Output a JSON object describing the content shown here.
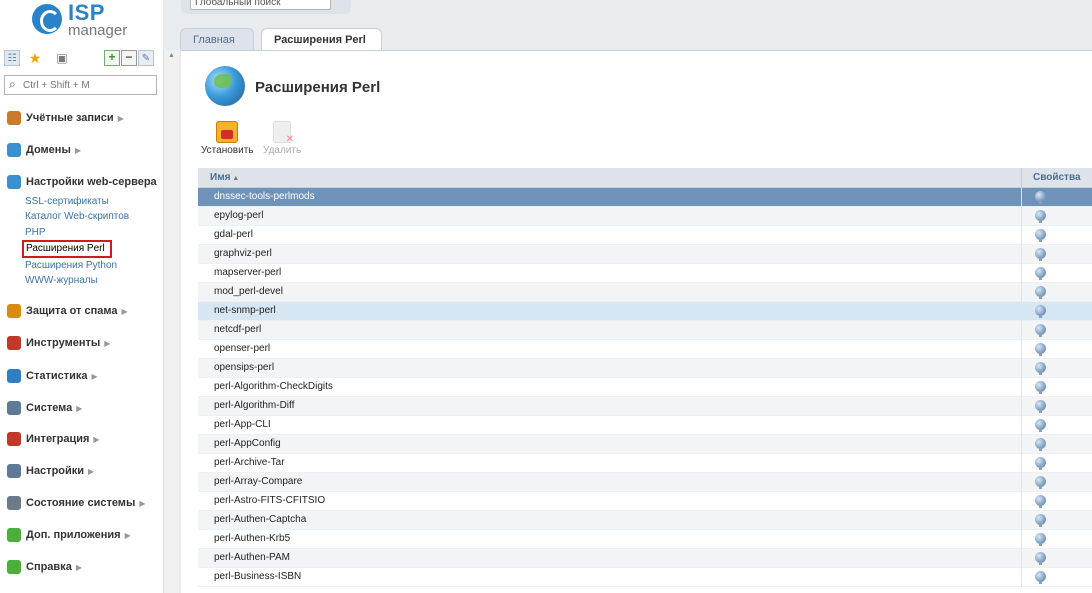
{
  "app": {
    "logo_main": "ISP",
    "logo_sub": "manager"
  },
  "global_search": {
    "placeholder": "Глобальный поиск"
  },
  "sidebar": {
    "search_placeholder": "Ctrl + Shift + M",
    "groups": [
      {
        "label": "Учётные записи",
        "icon": "users-icon",
        "color": "#c97a2b"
      },
      {
        "label": "Домены",
        "icon": "globe-icon",
        "color": "#3a8fcf"
      },
      {
        "label": "Настройки web-сервера",
        "icon": "web-globe-icon",
        "color": "#3a8fcf",
        "items": [
          "SSL-сертификаты",
          "Каталог Web-скриптов",
          "PHP",
          "Расширения Perl",
          "Расширения Python",
          "WWW-журналы"
        ]
      },
      {
        "label": "Защита от спама",
        "icon": "shield-icon",
        "color": "#d98a12"
      },
      {
        "label": "Инструменты",
        "icon": "tools-icon",
        "color": "#c0392b"
      },
      {
        "label": "Статистика",
        "icon": "pie-chart-icon",
        "color": "#2f7ec4"
      },
      {
        "label": "Система",
        "icon": "system-icon",
        "color": "#5f7a96"
      },
      {
        "label": "Интеграция",
        "icon": "puzzle-icon",
        "color": "#c0392b"
      },
      {
        "label": "Настройки",
        "icon": "settings-icon",
        "color": "#5f7a96"
      },
      {
        "label": "Состояние системы",
        "icon": "monitor-icon",
        "color": "#6b7b8a"
      },
      {
        "label": "Доп. приложения",
        "icon": "plus-icon",
        "color": "#4caf3c"
      },
      {
        "label": "Справка",
        "icon": "help-icon",
        "color": "#4caf3c"
      }
    ]
  },
  "tabs": [
    {
      "label": "Главная"
    },
    {
      "label": "Расширения Perl"
    }
  ],
  "page": {
    "title": "Расширения Perl",
    "actions": {
      "install": "Установить",
      "delete": "Удалить"
    }
  },
  "table": {
    "columns": {
      "name": "Имя",
      "props": "Свойства"
    },
    "rows": [
      "dnssec-tools-perlmods",
      "epylog-perl",
      "gdal-perl",
      "graphviz-perl",
      "mapserver-perl",
      "mod_perl-devel",
      "net-snmp-perl",
      "netcdf-perl",
      "openser-perl",
      "opensips-perl",
      "perl-Algorithm-CheckDigits",
      "perl-Algorithm-Diff",
      "perl-App-CLI",
      "perl-AppConfig",
      "perl-Archive-Tar",
      "perl-Array-Compare",
      "perl-Astro-FITS-CFITSIO",
      "perl-Authen-Captcha",
      "perl-Authen-Krb5",
      "perl-Authen-PAM",
      "perl-Business-ISBN"
    ]
  }
}
